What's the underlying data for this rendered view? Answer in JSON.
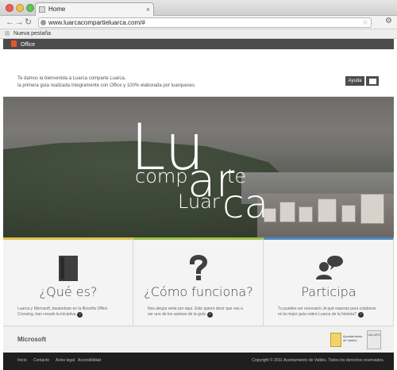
{
  "browser": {
    "tab_title": "Home",
    "tab_close": "×",
    "back_icon": "back-arrow-icon",
    "forward_icon": "forward-arrow-icon",
    "reload_icon": "reload-icon",
    "url": "www.luarcacompartieluarca.com/#",
    "bookmark_item": "Nueva pestaña"
  },
  "office_bar": {
    "label": "Office"
  },
  "intro": {
    "line1": "Te damos la bienvenida a Luarca comparte Luarca,",
    "line2": "la primera guía realizada íntegramente con Office y 100% elaborada por luarqueses.",
    "help": "Ayuda"
  },
  "hero": {
    "lu": "Lu",
    "comp": "comp",
    "ar": "ar",
    "te": "te",
    "luar": "Luar",
    "ca": "ca"
  },
  "columns": [
    {
      "title": "¿Qué es?",
      "text": "Luarca y Microsoft, basándose en la filosofía Office Crossing, han creado la iniciativa",
      "icon": "book-icon"
    },
    {
      "title": "¿Cómo funciona?",
      "text": "Nos alegra verte por aquí. Esto quiere decir que vas a ser uno de los autores de la guía",
      "icon": "question-icon"
    },
    {
      "title": "Participa",
      "text": "Tu puedes ser necesario ¡A qué esperas para colaborar en la mejor guía sobre Luarca de la historia?",
      "icon": "people-chat-icon"
    }
  ],
  "footer": {
    "brand": "Microsoft",
    "seal1_text": "Ayuntamiento de Valdés",
    "seal2_text": "VALDÉS",
    "nav": [
      "Inicio",
      "Contacto",
      "Aviso legal",
      "Accesibilidad"
    ],
    "copyright": "Copyright © 2011 Ayuntamiento de Valdés. Todos los derechos reservados."
  },
  "colors": {
    "office_bar": "#4b4b4b",
    "footer": "#1f1f1f",
    "accent_yellow": "#dbc24c",
    "accent_green": "#9cc04a",
    "accent_blue": "#4c8bc7"
  }
}
